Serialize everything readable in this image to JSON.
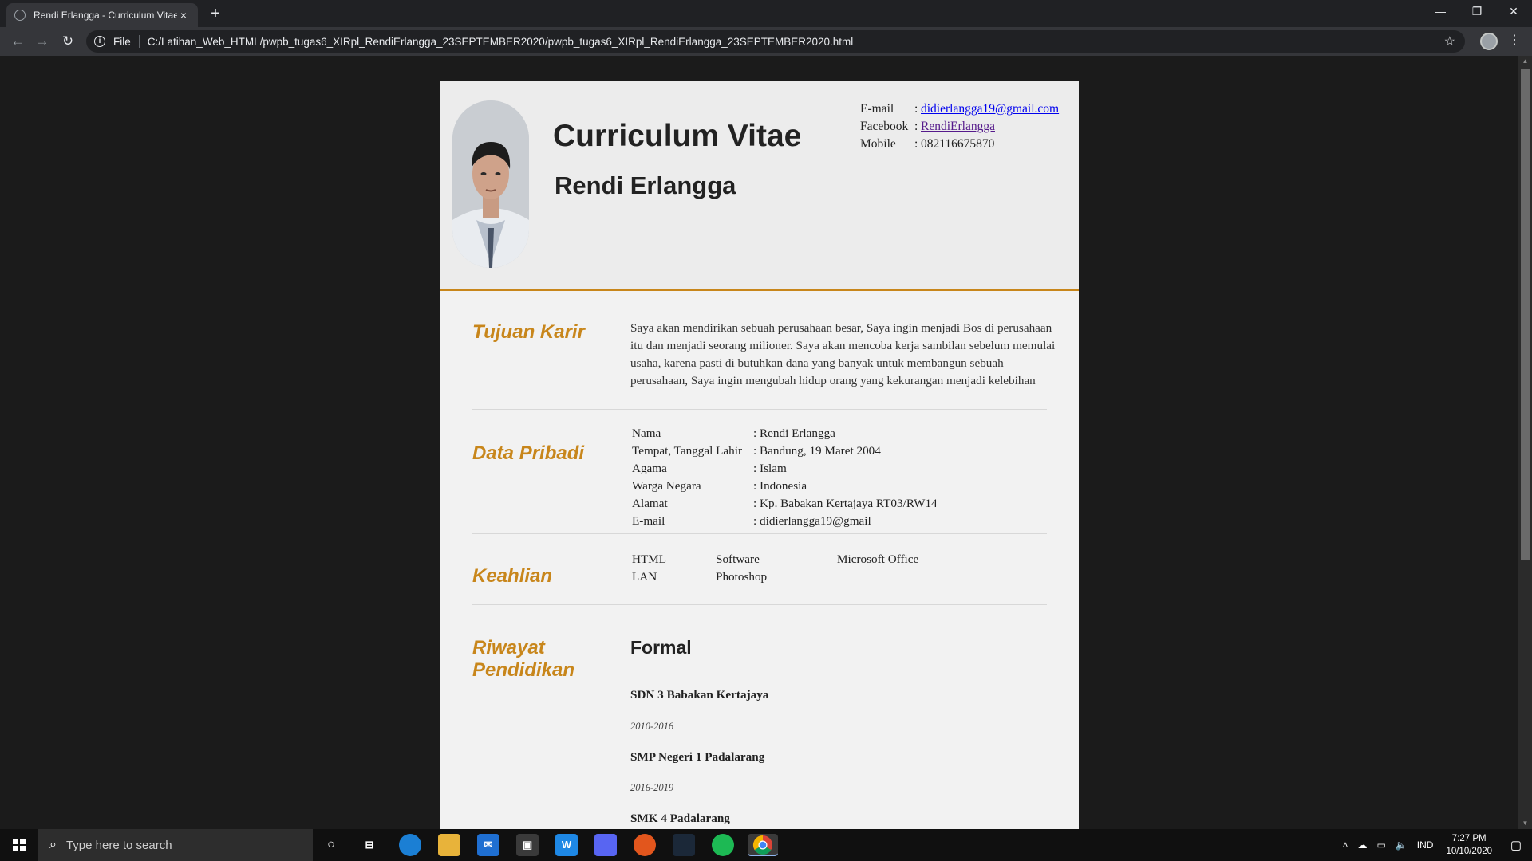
{
  "browser": {
    "tab_title": "Rendi Erlangga - Curriculum Vitae",
    "tab_close": "×",
    "new_tab": "+",
    "scheme": "File",
    "url": "C:/Latihan_Web_HTML/pwpb_tugas6_XIRpl_RendiErlangga_23SEPTEMBER2020/pwpb_tugas6_XIRpl_RendiErlangga_23SEPTEMBER2020.html",
    "controls": {
      "minimize": "—",
      "restore": "❐",
      "close": "✕"
    },
    "nav": {
      "back": "←",
      "forward": "→",
      "reload": "↻",
      "star": "☆",
      "menu": "⋮"
    }
  },
  "cv": {
    "title": "Curriculum Vitae",
    "name": "Rendi Erlangga",
    "contact": {
      "email_label": "E-mail",
      "email_value": "didierlangga19@gmail.com",
      "facebook_label": "Facebook",
      "facebook_value": "RendiErlangga",
      "mobile_label": "Mobile",
      "mobile_value": "082116675870",
      "colon": ":"
    },
    "sections": {
      "tujuan_title": "Tujuan Karir",
      "tujuan_text": "Saya akan mendirikan sebuah perusahaan besar, Saya ingin menjadi Bos di perusahaan itu dan menjadi seorang milioner. Saya akan mencoba kerja sambilan sebelum memulai usaha, karena pasti di butuhkan dana yang banyak untuk membangun sebuah perusahaan, Saya ingin mengubah hidup orang yang kekurangan menjadi kelebihan",
      "data_title": "Data Pribadi",
      "data_rows": [
        {
          "label": "Nama",
          "value": ": Rendi Erlangga"
        },
        {
          "label": "Tempat, Tanggal Lahir",
          "value": ": Bandung, 19 Maret 2004"
        },
        {
          "label": "Agama",
          "value": ": Islam"
        },
        {
          "label": "Warga Negara",
          "value": ": Indonesia"
        },
        {
          "label": "Alamat",
          "value": ": Kp. Babakan Kertajaya RT03/RW14"
        },
        {
          "label": "E-mail",
          "value": ": didierlangga19@gmail"
        }
      ],
      "keahlian_title": "Keahlian",
      "skills": [
        "HTML",
        "Software",
        "Microsoft Office",
        "LAN",
        "Photoshop"
      ],
      "pendidikan_title_1": "Riwayat",
      "pendidikan_title_2": "Pendidikan",
      "formal": "Formal",
      "schools": [
        {
          "name": "SDN 3 Babakan Kertajaya",
          "years": "2010-2016"
        },
        {
          "name": "SMP Negeri 1 Padalarang",
          "years": "2016-2019"
        },
        {
          "name": "SMK 4 Padalarang"
        }
      ]
    }
  },
  "taskbar": {
    "search_placeholder": "Type here to search",
    "language": "IND",
    "time": "7:27 PM",
    "date": "10/10/2020"
  },
  "colors": {
    "accent": "#c8861b",
    "page_bg": "#1b1b1b",
    "cv_bg": "#f2f2f2",
    "link": "#0000ee"
  }
}
